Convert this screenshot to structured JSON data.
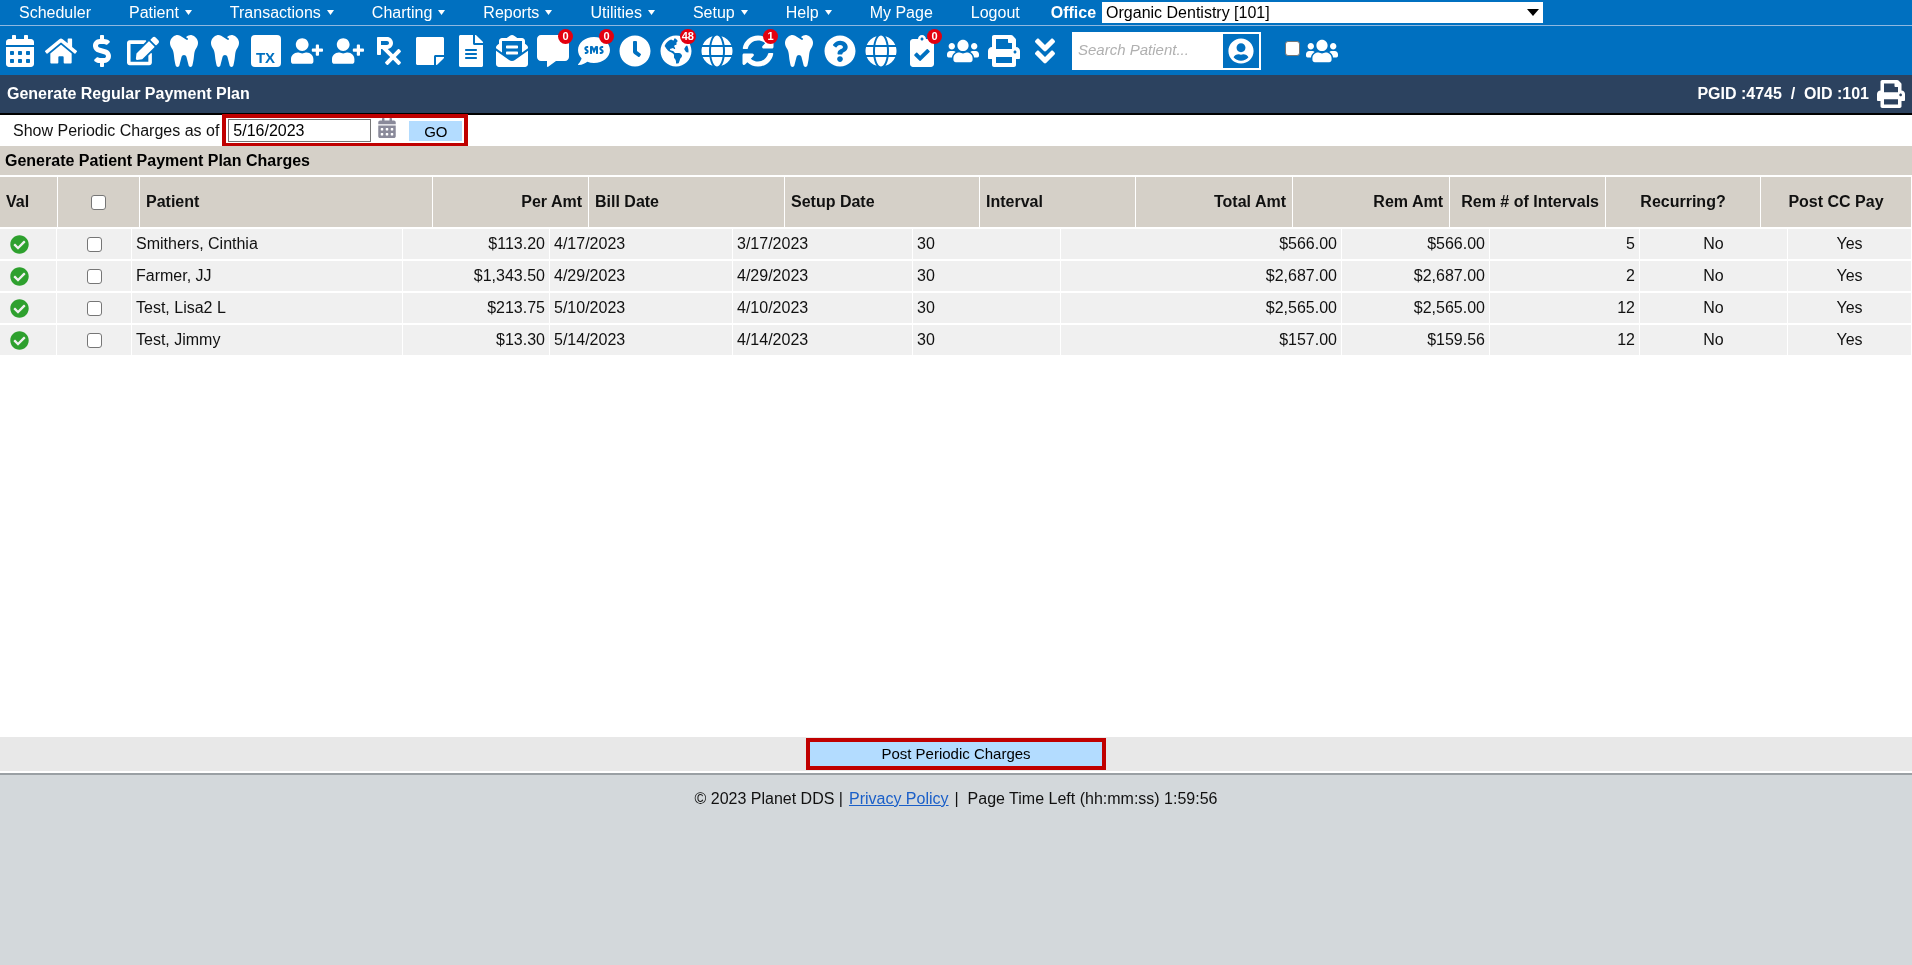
{
  "menu": [
    {
      "label": "Scheduler",
      "has_menu": false
    },
    {
      "label": "Patient",
      "has_menu": true
    },
    {
      "label": "Transactions",
      "has_menu": true
    },
    {
      "label": "Charting",
      "has_menu": true
    },
    {
      "label": "Reports",
      "has_menu": true
    },
    {
      "label": "Utilities",
      "has_menu": true
    },
    {
      "label": "Setup",
      "has_menu": true
    },
    {
      "label": "Help",
      "has_menu": true
    },
    {
      "label": "My Page",
      "has_menu": false
    },
    {
      "label": "Logout",
      "has_menu": false
    }
  ],
  "office": {
    "label": "Office",
    "value": "Organic Dentistry [101]"
  },
  "toolbar": [
    {
      "kind": "calendar"
    },
    {
      "kind": "home"
    },
    {
      "kind": "dollar"
    },
    {
      "kind": "edit"
    },
    {
      "kind": "tooth"
    },
    {
      "kind": "tooth"
    },
    {
      "kind": "tx",
      "label": "TX"
    },
    {
      "kind": "user-plus"
    },
    {
      "kind": "user-plus"
    },
    {
      "kind": "rx"
    },
    {
      "kind": "note"
    },
    {
      "kind": "file"
    },
    {
      "kind": "mail"
    },
    {
      "kind": "chat",
      "badge": "0"
    },
    {
      "kind": "sms",
      "badge": "0"
    },
    {
      "kind": "clock"
    },
    {
      "kind": "globe-user",
      "badge": "48"
    },
    {
      "kind": "globe"
    },
    {
      "kind": "sync",
      "badge": "1"
    },
    {
      "kind": "tooth"
    },
    {
      "kind": "question"
    },
    {
      "kind": "globe"
    },
    {
      "kind": "checklist",
      "badge": "0"
    },
    {
      "kind": "users"
    },
    {
      "kind": "print"
    },
    {
      "kind": "chevrons"
    }
  ],
  "search": {
    "placeholder": "Search Patient...",
    "checked": false
  },
  "header": {
    "title": "Generate Regular Payment Plan",
    "ids": "PGID :4745  /  OID :101"
  },
  "filter": {
    "label": "Show Periodic Charges as of",
    "date": "5/16/2023",
    "go": "GO"
  },
  "section_title": "Generate Patient Payment Plan Charges",
  "table": {
    "columns": [
      "Val",
      "",
      "Patient",
      "Per Amt",
      "Bill Date",
      "Setup Date",
      "Interval",
      "Total Amt",
      "Rem Amt",
      "Rem # of Intervals",
      "Recurring?",
      "Post CC Pay"
    ],
    "select_all": false,
    "rows": [
      {
        "valid": true,
        "checked": false,
        "patient": "Smithers, Cinthia",
        "per_amt": "$113.20",
        "bill_date": "4/17/2023",
        "setup_date": "3/17/2023",
        "interval": "30",
        "total_amt": "$566.00",
        "rem_amt": "$566.00",
        "rem_intervals": "5",
        "recurring": "No",
        "post_cc_pay": "Yes"
      },
      {
        "valid": true,
        "checked": false,
        "patient": "Farmer, JJ",
        "per_amt": "$1,343.50",
        "bill_date": "4/29/2023",
        "setup_date": "4/29/2023",
        "interval": "30",
        "total_amt": "$2,687.00",
        "rem_amt": "$2,687.00",
        "rem_intervals": "2",
        "recurring": "No",
        "post_cc_pay": "Yes"
      },
      {
        "valid": true,
        "checked": false,
        "patient": "Test, Lisa2 L",
        "per_amt": "$213.75",
        "bill_date": "5/10/2023",
        "setup_date": "4/10/2023",
        "interval": "30",
        "total_amt": "$2,565.00",
        "rem_amt": "$2,565.00",
        "rem_intervals": "12",
        "recurring": "No",
        "post_cc_pay": "Yes"
      },
      {
        "valid": true,
        "checked": false,
        "patient": "Test, Jimmy",
        "per_amt": "$13.30",
        "bill_date": "5/14/2023",
        "setup_date": "4/14/2023",
        "interval": "30",
        "total_amt": "$157.00",
        "rem_amt": "$159.56",
        "rem_intervals": "12",
        "recurring": "No",
        "post_cc_pay": "Yes"
      }
    ]
  },
  "post_button": "Post Periodic Charges",
  "footer": {
    "copyright": "© 2023 Planet DDS |",
    "link": "Privacy Policy",
    "time_left": "|  Page Time Left (hh:mm:ss) 1:59:56"
  }
}
